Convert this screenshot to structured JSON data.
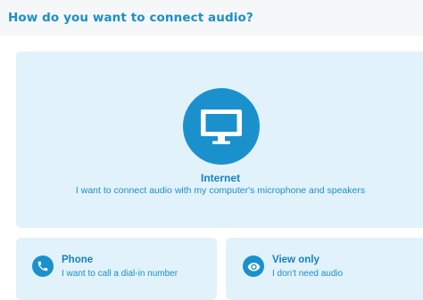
{
  "dialog": {
    "title": "How do you want to connect audio?"
  },
  "options": {
    "internet": {
      "title": "Internet",
      "description": "I want to connect audio with my computer's microphone and speakers",
      "icon": "monitor-icon"
    },
    "phone": {
      "title": "Phone",
      "description": "I want to call a dial-in number",
      "icon": "phone-icon"
    },
    "view_only": {
      "title": "View only",
      "description": "I don't need audio",
      "icon": "eye-icon"
    }
  },
  "colors": {
    "accent": "#1a91cc",
    "card_background": "#e2f2fb",
    "header_background": "#f6f7f8"
  }
}
